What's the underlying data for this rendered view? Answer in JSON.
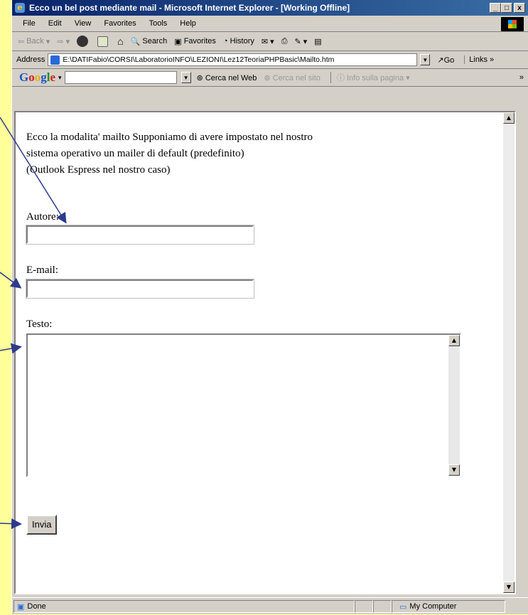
{
  "window": {
    "title": "Ecco un bel post mediante mail - Microsoft Internet Explorer - [Working Offline]",
    "controls": [
      "_",
      "□",
      "x"
    ]
  },
  "menu": [
    "File",
    "Edit",
    "View",
    "Favorites",
    "Tools",
    "Help"
  ],
  "toolbar": {
    "back": "Back",
    "search": "Search",
    "favorites": "Favorites",
    "history": "History"
  },
  "address": {
    "label": "Address",
    "url": "E:\\DATIFabio\\CORSI\\LaboratorioINFO\\LEZIONI\\Lez12TeoriaPHPBasic\\Mailto.htm",
    "go": "Go",
    "links": "Links"
  },
  "google": {
    "logo": "Google",
    "search_web": "Cerca nel Web",
    "search_site": "Cerca nel sito",
    "page_info": "Info sulla pagina"
  },
  "page": {
    "intro_lines": [
      "Ecco la modalita' mailto Supponiamo di avere impostato nel nostro",
      "sistema operativo un mailer di default (predefinito)",
      "(Outlook Espress nel nostro caso)"
    ],
    "author_label": "Autore:",
    "email_label": "E-mail:",
    "text_label": "Testo:",
    "submit_label": "Invia"
  },
  "status": {
    "text": "Done",
    "zone": "My Computer"
  },
  "colors": {
    "slide_bg": "#ffff99",
    "title_bar": "#0a246a",
    "arrow": "#2e3a8c"
  }
}
